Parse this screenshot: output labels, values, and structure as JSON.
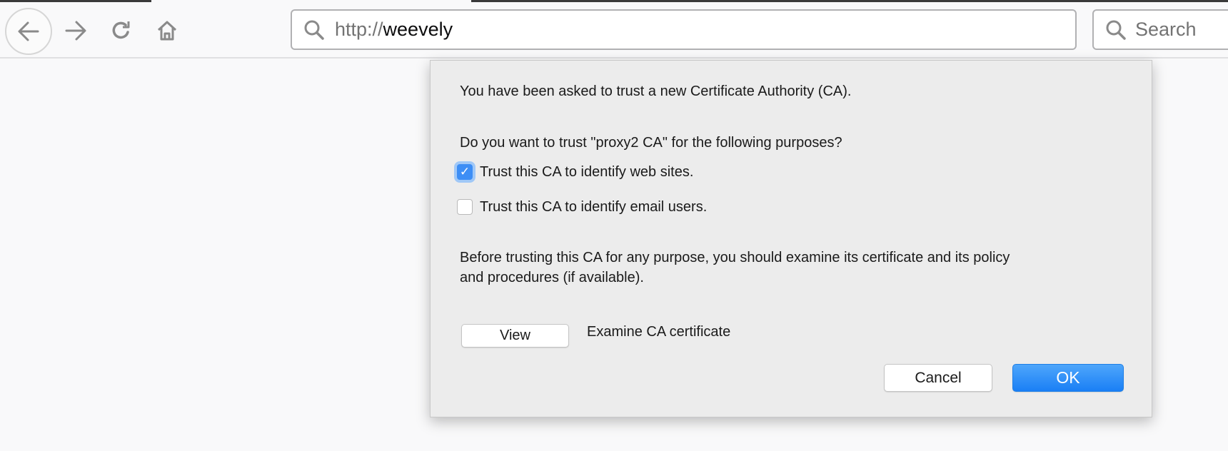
{
  "browser": {
    "url_protocol": "http://",
    "url_host": "weevely",
    "search_placeholder": "Search"
  },
  "dialog": {
    "intro": "You have been asked to trust a new Certificate Authority (CA).",
    "question": "Do you want to trust \"proxy2 CA\" for the following purposes?",
    "options": [
      {
        "label": "Trust this CA to identify web sites.",
        "checked": true
      },
      {
        "label": "Trust this CA to identify email users.",
        "checked": false
      }
    ],
    "advice_line1": "Before trusting this CA for any purpose, you should examine its certificate and its policy",
    "advice_line2": "and procedures (if available).",
    "view_label": "View",
    "view_desc": "Examine CA certificate",
    "cancel_label": "Cancel",
    "ok_label": "OK",
    "accent": "#3d8ef5"
  }
}
